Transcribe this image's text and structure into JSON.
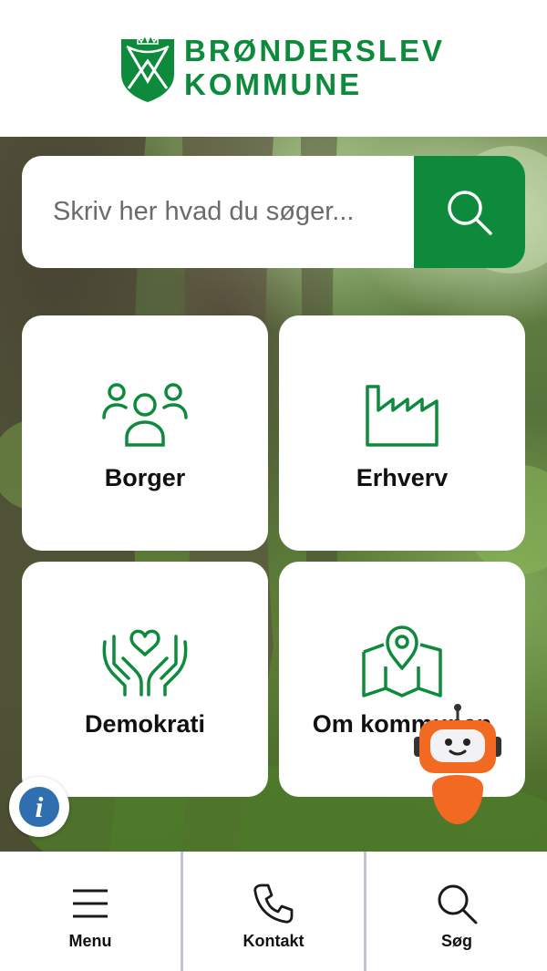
{
  "brand": {
    "name_line1": "BRØNDERSLEV",
    "name_line2": "KOMMUNE",
    "color": "#0d8a3c"
  },
  "search": {
    "placeholder": "Skriv her hvad du søger...",
    "button_icon": "search-icon"
  },
  "tiles": [
    {
      "label": "Borger",
      "icon": "people-group-icon"
    },
    {
      "label": "Erhverv",
      "icon": "factory-icon"
    },
    {
      "label": "Demokrati",
      "icon": "hands-heart-icon"
    },
    {
      "label": "Om kommunen",
      "icon": "map-pin-icon"
    }
  ],
  "widgets": {
    "info_symbol": "i",
    "chatbot_icon": "chatbot-robot-icon"
  },
  "bottom_nav": [
    {
      "label": "Menu",
      "icon": "hamburger-menu-icon"
    },
    {
      "label": "Kontakt",
      "icon": "phone-icon"
    },
    {
      "label": "Søg",
      "icon": "search-icon"
    }
  ]
}
